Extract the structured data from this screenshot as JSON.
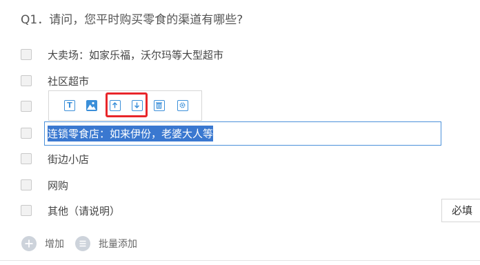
{
  "question": {
    "title": "Q1．请问，您平时购买零食的渠道有哪些?"
  },
  "options": [
    {
      "label": "大卖场：如家乐福，沃尔玛等大型超市"
    },
    {
      "label": "社区超市"
    },
    {
      "label": ""
    },
    {
      "label": ""
    },
    {
      "label": "街边小店"
    },
    {
      "label": "网购"
    },
    {
      "label": "其他（请说明）"
    }
  ],
  "editor": {
    "value": "连锁零食店：如来伊份，老婆大人等"
  },
  "toolbar": {
    "icons": [
      "text-icon",
      "image-icon",
      "move-up-icon",
      "move-down-icon",
      "delete-icon",
      "settings-icon"
    ],
    "highlight_color": "#e8262a",
    "icon_color": "#3b8fd9"
  },
  "required_label": "必填",
  "actions": {
    "add_label": "增加",
    "batch_add_label": "批量添加"
  }
}
